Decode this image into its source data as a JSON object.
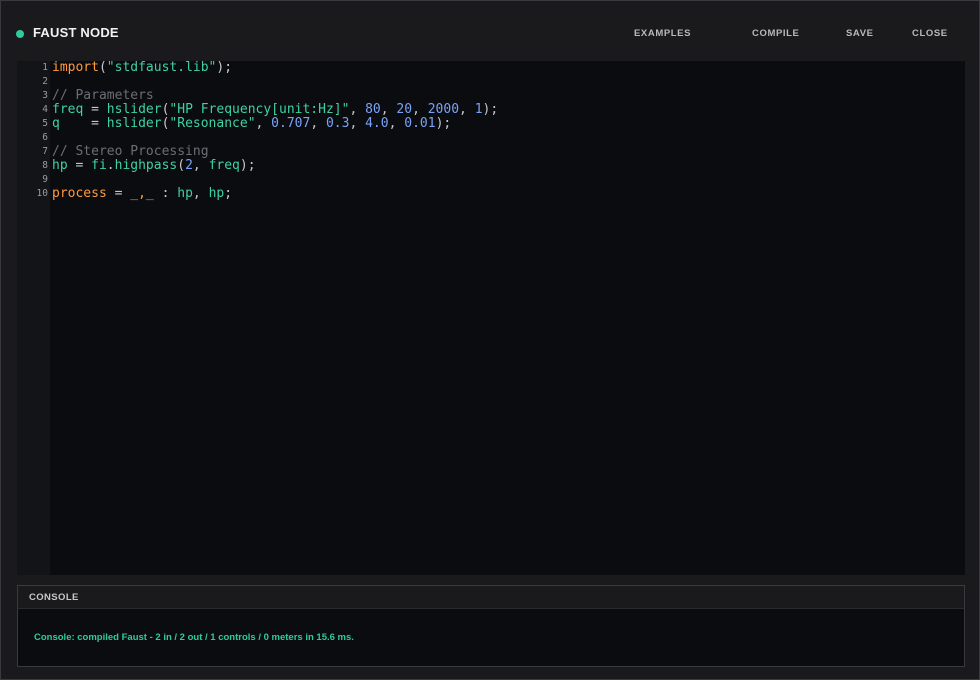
{
  "app": {
    "title": "FAUST NODE",
    "status_color": "#2ecc9a",
    "status_icon": "status-dot-icon"
  },
  "toolbar": {
    "examples_label": "EXAMPLES",
    "compile_label": "COMPILE",
    "save_label": "SAVE",
    "close_label": "CLOSE"
  },
  "editor": {
    "lines": [
      {
        "num": "1",
        "tokens": [
          {
            "t": "import",
            "k": "kw"
          },
          {
            "t": "(",
            "k": "plain"
          },
          {
            "t": "\"stdfaust.lib\"",
            "k": "str"
          },
          {
            "t": ");",
            "k": "plain"
          }
        ]
      },
      {
        "num": "2",
        "tokens": []
      },
      {
        "num": "3",
        "tokens": [
          {
            "t": "// Parameters",
            "k": "comment"
          }
        ]
      },
      {
        "num": "4",
        "tokens": [
          {
            "t": "freq",
            "k": "ident"
          },
          {
            "t": " = ",
            "k": "plain"
          },
          {
            "t": "hslider",
            "k": "ident"
          },
          {
            "t": "(",
            "k": "plain"
          },
          {
            "t": "\"HP Frequency[unit:Hz]\"",
            "k": "str"
          },
          {
            "t": ", ",
            "k": "plain"
          },
          {
            "t": "80",
            "k": "num"
          },
          {
            "t": ", ",
            "k": "plain"
          },
          {
            "t": "20",
            "k": "num"
          },
          {
            "t": ", ",
            "k": "plain"
          },
          {
            "t": "2000",
            "k": "num"
          },
          {
            "t": ", ",
            "k": "plain"
          },
          {
            "t": "1",
            "k": "num"
          },
          {
            "t": ");",
            "k": "plain"
          }
        ]
      },
      {
        "num": "5",
        "tokens": [
          {
            "t": "q",
            "k": "ident"
          },
          {
            "t": "    = ",
            "k": "plain"
          },
          {
            "t": "hslider",
            "k": "ident"
          },
          {
            "t": "(",
            "k": "plain"
          },
          {
            "t": "\"Resonance\"",
            "k": "str"
          },
          {
            "t": ", ",
            "k": "plain"
          },
          {
            "t": "0.707",
            "k": "num"
          },
          {
            "t": ", ",
            "k": "plain"
          },
          {
            "t": "0.3",
            "k": "num"
          },
          {
            "t": ", ",
            "k": "plain"
          },
          {
            "t": "4.0",
            "k": "num"
          },
          {
            "t": ", ",
            "k": "plain"
          },
          {
            "t": "0.01",
            "k": "num"
          },
          {
            "t": ");",
            "k": "plain"
          }
        ]
      },
      {
        "num": "6",
        "tokens": []
      },
      {
        "num": "7",
        "tokens": [
          {
            "t": "// Stereo Processing",
            "k": "comment"
          }
        ]
      },
      {
        "num": "8",
        "tokens": [
          {
            "t": "hp",
            "k": "ident"
          },
          {
            "t": " = ",
            "k": "plain"
          },
          {
            "t": "fi",
            "k": "ident"
          },
          {
            "t": ".",
            "k": "plain"
          },
          {
            "t": "highpass",
            "k": "ident"
          },
          {
            "t": "(",
            "k": "plain"
          },
          {
            "t": "2",
            "k": "num"
          },
          {
            "t": ", ",
            "k": "plain"
          },
          {
            "t": "freq",
            "k": "ident"
          },
          {
            "t": ");",
            "k": "plain"
          }
        ]
      },
      {
        "num": "9",
        "tokens": []
      },
      {
        "num": "10",
        "tokens": [
          {
            "t": "process",
            "k": "kw"
          },
          {
            "t": " = ",
            "k": "plain"
          },
          {
            "t": "_,_",
            "k": "kw"
          },
          {
            "t": " : ",
            "k": "plain"
          },
          {
            "t": "hp",
            "k": "ident"
          },
          {
            "t": ", ",
            "k": "plain"
          },
          {
            "t": "hp",
            "k": "ident"
          },
          {
            "t": ";",
            "k": "plain"
          }
        ]
      }
    ]
  },
  "console": {
    "title": "CONSOLE",
    "message": "Console: compiled Faust - 2 in / 2 out / 1 controls / 0 meters in 15.6 ms.",
    "message_color": "#2ecc9a"
  }
}
